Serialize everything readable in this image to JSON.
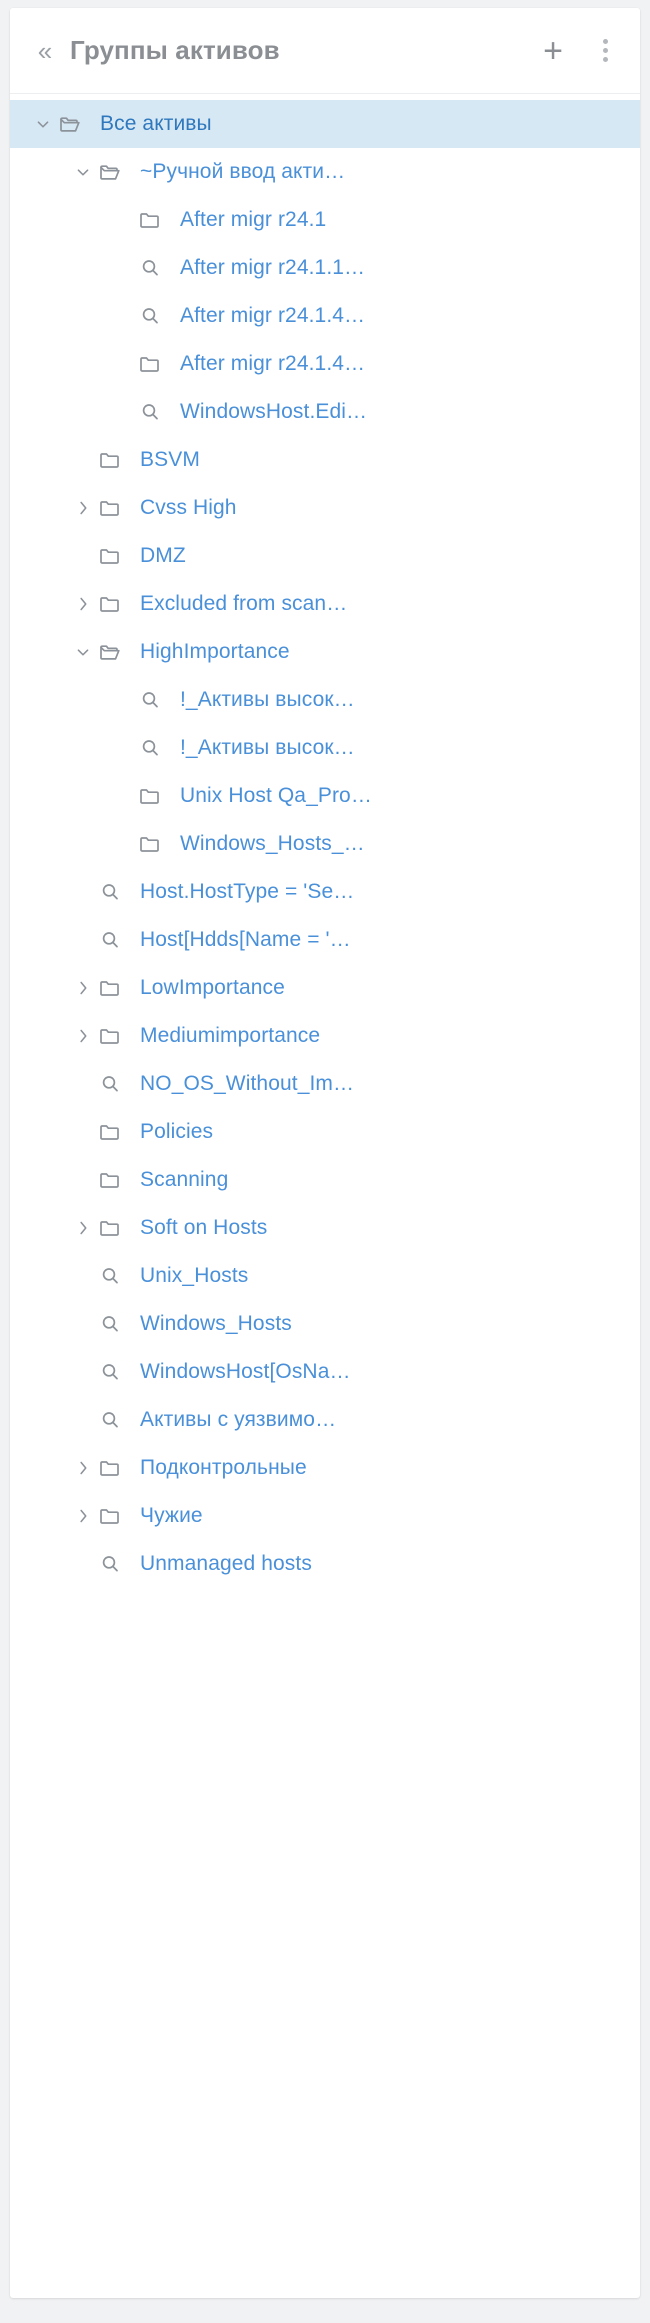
{
  "header": {
    "collapse_icon": "double-chevron-left-icon",
    "title": "Группы активов",
    "add_icon": "plus-icon",
    "more_icon": "kebab-menu-icon"
  },
  "colors": {
    "panel_bg": "#ffffff",
    "page_bg": "#f1f2f3",
    "link": "#4a90d9",
    "selected_row": "#d7e8f5",
    "icon_gray": "#8c9299",
    "title_gray": "#8b8f94"
  },
  "tree": {
    "items": [
      {
        "label": "Все активы",
        "icon": "folder-open-icon",
        "twisty": "down",
        "indent": 0,
        "selected": true
      },
      {
        "label": "~Ручной ввод акти…",
        "icon": "folder-open-icon",
        "twisty": "down",
        "indent": 1,
        "selected": false
      },
      {
        "label": "After migr r24.1",
        "icon": "folder-icon",
        "twisty": "none",
        "indent": 2,
        "selected": false
      },
      {
        "label": "After migr r24.1.1…",
        "icon": "search-icon",
        "twisty": "none",
        "indent": 2,
        "selected": false
      },
      {
        "label": "After migr r24.1.4…",
        "icon": "search-icon",
        "twisty": "none",
        "indent": 2,
        "selected": false
      },
      {
        "label": "After migr r24.1.4…",
        "icon": "folder-icon",
        "twisty": "none",
        "indent": 2,
        "selected": false
      },
      {
        "label": "WindowsHost.Edi…",
        "icon": "search-icon",
        "twisty": "none",
        "indent": 2,
        "selected": false
      },
      {
        "label": "BSVM",
        "icon": "folder-icon",
        "twisty": "none",
        "indent": 1,
        "selected": false
      },
      {
        "label": "Cvss High",
        "icon": "folder-icon",
        "twisty": "right",
        "indent": 1,
        "selected": false
      },
      {
        "label": "DMZ",
        "icon": "folder-icon",
        "twisty": "none",
        "indent": 1,
        "selected": false
      },
      {
        "label": "Excluded from scan…",
        "icon": "folder-icon",
        "twisty": "right",
        "indent": 1,
        "selected": false
      },
      {
        "label": "HighImportance",
        "icon": "folder-open-icon",
        "twisty": "down",
        "indent": 1,
        "selected": false
      },
      {
        "label": "!_Активы высок…",
        "icon": "search-icon",
        "twisty": "none",
        "indent": 2,
        "selected": false
      },
      {
        "label": "!_Активы высок…",
        "icon": "search-icon",
        "twisty": "none",
        "indent": 2,
        "selected": false
      },
      {
        "label": "Unix Host Qa_Pro…",
        "icon": "folder-icon",
        "twisty": "none",
        "indent": 2,
        "selected": false
      },
      {
        "label": "Windows_Hosts_…",
        "icon": "folder-icon",
        "twisty": "none",
        "indent": 2,
        "selected": false
      },
      {
        "label": "Host.HostType = 'Se…",
        "icon": "search-icon",
        "twisty": "none",
        "indent": 1,
        "selected": false
      },
      {
        "label": "Host[Hdds[Name = '…",
        "icon": "search-icon",
        "twisty": "none",
        "indent": 1,
        "selected": false
      },
      {
        "label": "LowImportance",
        "icon": "folder-icon",
        "twisty": "right",
        "indent": 1,
        "selected": false
      },
      {
        "label": "Mediumimportance",
        "icon": "folder-icon",
        "twisty": "right",
        "indent": 1,
        "selected": false
      },
      {
        "label": "NO_OS_Without_Im…",
        "icon": "search-icon",
        "twisty": "none",
        "indent": 1,
        "selected": false
      },
      {
        "label": "Policies",
        "icon": "folder-icon",
        "twisty": "none",
        "indent": 1,
        "selected": false
      },
      {
        "label": "Scanning",
        "icon": "folder-icon",
        "twisty": "none",
        "indent": 1,
        "selected": false
      },
      {
        "label": "Soft on Hosts",
        "icon": "folder-icon",
        "twisty": "right",
        "indent": 1,
        "selected": false
      },
      {
        "label": "Unix_Hosts",
        "icon": "search-icon",
        "twisty": "none",
        "indent": 1,
        "selected": false
      },
      {
        "label": "Windows_Hosts",
        "icon": "search-icon",
        "twisty": "none",
        "indent": 1,
        "selected": false
      },
      {
        "label": "WindowsHost[OsNa…",
        "icon": "search-icon",
        "twisty": "none",
        "indent": 1,
        "selected": false
      },
      {
        "label": "Активы с уязвимо…",
        "icon": "search-icon",
        "twisty": "none",
        "indent": 1,
        "selected": false
      },
      {
        "label": "Подконтрольные",
        "icon": "folder-icon",
        "twisty": "right",
        "indent": 1,
        "selected": false
      },
      {
        "label": "Чужие",
        "icon": "folder-icon",
        "twisty": "right",
        "indent": 1,
        "selected": false
      },
      {
        "label": "Unmanaged hosts",
        "icon": "search-icon",
        "twisty": "none",
        "indent": 1,
        "selected": false
      }
    ]
  }
}
